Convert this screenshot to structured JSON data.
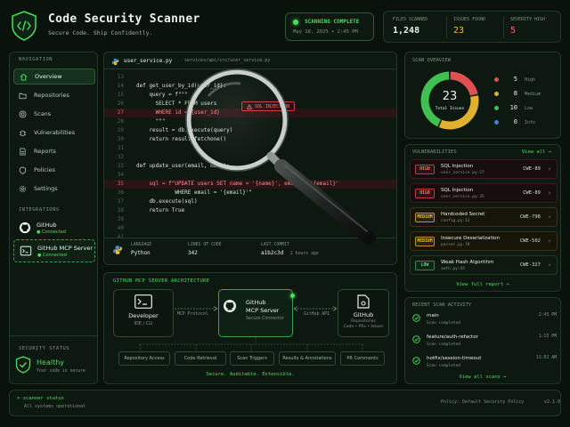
{
  "header": {
    "title": "Code Security Scanner",
    "subtitle": "Secure Code. Ship Confidently."
  },
  "scan_status": {
    "label": "SCANNING COMPLETE",
    "timestamp": "May 18, 2025 • 2:45 PM"
  },
  "stats": [
    {
      "label": "FILES SCANNED",
      "value": "1,248",
      "color": "#e8f3ea"
    },
    {
      "label": "ISSUES FOUND",
      "value": "23",
      "color": "#f0c040"
    },
    {
      "label": "SEVERITY HIGH",
      "value": "5",
      "color": "#ff6b6b"
    }
  ],
  "sidebar": {
    "nav_heading": "NAVIGATION",
    "items": [
      {
        "label": "Overview",
        "icon": "home-icon"
      },
      {
        "label": "Repositories",
        "icon": "folder-icon"
      },
      {
        "label": "Scans",
        "icon": "target-icon"
      },
      {
        "label": "Vulnerabilities",
        "icon": "bug-icon"
      },
      {
        "label": "Reports",
        "icon": "document-icon"
      },
      {
        "label": "Policies",
        "icon": "shield-icon"
      },
      {
        "label": "Settings",
        "icon": "gear-icon"
      }
    ],
    "integrations_heading": "INTEGRATIONS",
    "integrations": [
      {
        "name": "GitHub",
        "status": "● Connected"
      },
      {
        "name": "GitHub MCP Server",
        "status": "● Connected"
      }
    ],
    "security_heading": "SECURITY STATUS",
    "security_status": "Healthy",
    "security_note": "Your code is secure"
  },
  "code": {
    "filename": "user_service.py",
    "path": "services/api/src/user_service.py",
    "lines": [
      {
        "n": "13",
        "t": ""
      },
      {
        "n": "14",
        "t": "def get_user_by_id(user_id):"
      },
      {
        "n": "15",
        "t": "    query = f\"\"\""
      },
      {
        "n": "26",
        "t": "      SELECT * FROM users"
      },
      {
        "n": "27",
        "t": "      WHERE id = {user_id}"
      },
      {
        "n": "28",
        "t": "      \"\"\""
      },
      {
        "n": "29",
        "t": "    result = db.execute(query)"
      },
      {
        "n": "30",
        "t": "    return result.fetchone()"
      },
      {
        "n": "31",
        "t": ""
      },
      {
        "n": "32",
        "t": ""
      },
      {
        "n": "33",
        "t": "def update_user(email, name):"
      },
      {
        "n": "34",
        "t": ""
      },
      {
        "n": "35",
        "t": "    sql = f\"UPDATE users SET name = '{name}', email = '{email}'"
      },
      {
        "n": "36",
        "t": "            WHERE email = '{email}'\""
      },
      {
        "n": "37",
        "t": "    db.execute(sql)"
      },
      {
        "n": "38",
        "t": "    return True"
      },
      {
        "n": "39",
        "t": ""
      },
      {
        "n": "40",
        "t": ""
      },
      {
        "n": "41",
        "t": ""
      }
    ],
    "tooltip": "SQL INJECTION",
    "meta": [
      {
        "label": "LANGUAGE",
        "value": "Python"
      },
      {
        "label": "LINES OF CODE",
        "value": "342"
      },
      {
        "label": "LAST COMMIT",
        "value": "a1b2c3d",
        "extra": "2 hours ago"
      }
    ]
  },
  "architecture": {
    "heading": "GITHUB MCP SERVER ARCHITECTURE",
    "developer": {
      "title": "Developer",
      "sub": "IDE / CLI"
    },
    "server": {
      "title": "GitHub",
      "title2": "MCP Server",
      "sub": "Secure Connector"
    },
    "github": {
      "title": "GitHub",
      "sub": "Repositories",
      "sub2": "Code • PRs • Issues"
    },
    "left_link": "MCP Protocol",
    "right_link": "GitHub API",
    "capabilities": [
      "Repository Access",
      "Code Retrieval",
      "Scan Triggers",
      "Results & Annotations",
      "PR Comments"
    ],
    "tagline": "Secure. Auditable. Extensible."
  },
  "overview": {
    "heading": "SCAN OVERVIEW",
    "total": "23",
    "total_label": "Total Issues",
    "legend": [
      {
        "count": "5",
        "label": "High",
        "color": "#e05050"
      },
      {
        "count": "8",
        "label": "Medium",
        "color": "#e0b030"
      },
      {
        "count": "10",
        "label": "Low",
        "color": "#40c050"
      },
      {
        "count": "0",
        "label": "Info",
        "color": "#4080e0"
      }
    ]
  },
  "vulnerabilities": {
    "heading": "VULNERABILITIES",
    "view_all": "View all →",
    "items": [
      {
        "sev": "HIGH",
        "name": "SQL Injection",
        "file": "user_service.py:27",
        "cwe": "CWE-89"
      },
      {
        "sev": "HIGH",
        "name": "SQL Injection",
        "file": "user_service.py:35",
        "cwe": "CWE-89"
      },
      {
        "sev": "MEDIUM",
        "name": "Hardcoded Secret",
        "file": "config.py:12",
        "cwe": "CWE-798"
      },
      {
        "sev": "MEDIUM",
        "name": "Insecure Deserialization",
        "file": "parser.py:78",
        "cwe": "CWE-502"
      },
      {
        "sev": "LOW",
        "name": "Weak Hash Algorithm",
        "file": "auth.py:45",
        "cwe": "CWE-327"
      }
    ],
    "full_report": "View full report →"
  },
  "recent": {
    "heading": "RECENT SCAN ACTIVITY",
    "items": [
      {
        "branch": "main",
        "status": "Scan completed",
        "time": "2:45 PM"
      },
      {
        "branch": "feature/auth-refactor",
        "status": "Scan completed",
        "time": "1:15 PM"
      },
      {
        "branch": "hotfix/session-timeout",
        "status": "Scan completed",
        "time": "11:02 AM"
      }
    ],
    "view_all": "View all scans →"
  },
  "footer": {
    "line1": "> scanner status",
    "line2": "All systems operational",
    "policy": "Policy: Default Security Policy",
    "version": "v2.1.0"
  }
}
